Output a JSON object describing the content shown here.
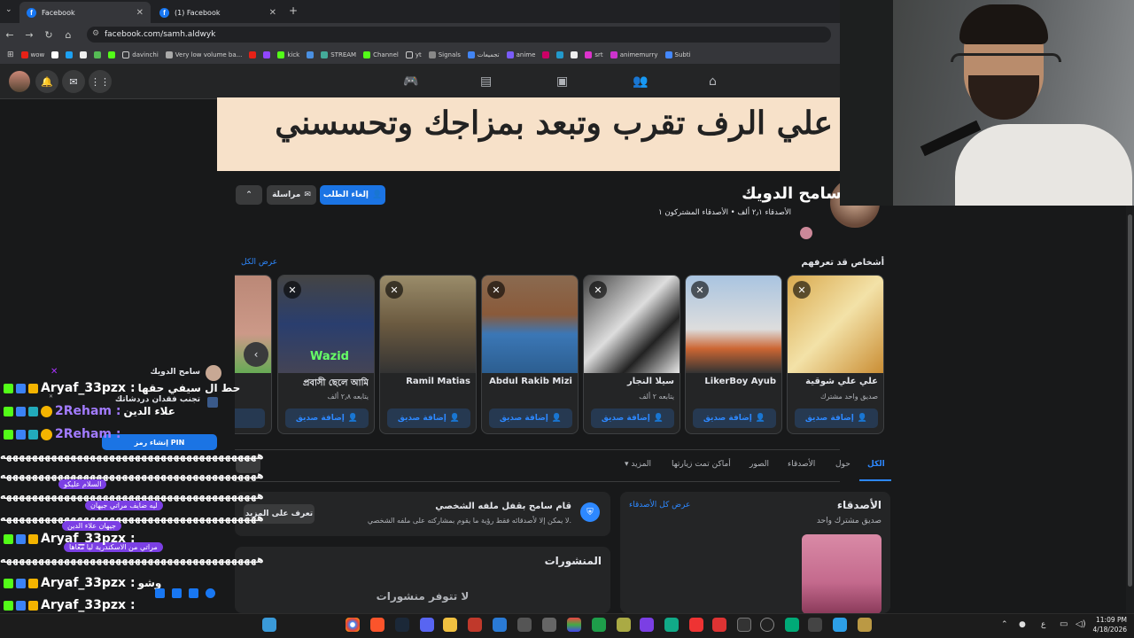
{
  "browser": {
    "tabs": [
      {
        "label": "Facebook"
      },
      {
        "label": "(1) Facebook"
      }
    ],
    "url": "facebook.com/samh.aldwyk",
    "bookmarks": [
      "wow",
      "davinchi",
      "Very low volume ba...",
      "kick",
      "STREAM",
      "Channel",
      "yt",
      "Signals",
      "تجميعات",
      "anime",
      "srt",
      "animemurry",
      "Subti"
    ]
  },
  "cover": {
    "text": "علي الرف تقرب وتبعد بمزاجك وتحسسني"
  },
  "profile": {
    "name": "سامح الدويك",
    "stats": "الأصدقاء ٢٫١ ألف • الأصدقاء المشتركون ١",
    "cancel_request": "إلغاء الطلب",
    "message": "مراسلة"
  },
  "pymk": {
    "title": "أشخاص قد تعرفهم",
    "see_all": "عرض الكل",
    "add_label": "إضافة صديق",
    "cards": [
      {
        "name": "علي علي شوقية",
        "sub": "صديق واحد مشترك"
      },
      {
        "name": "LikerBoy Ayub",
        "sub": ""
      },
      {
        "name": "سيلا النجار",
        "sub": "يتابعه ٢ ألف"
      },
      {
        "name": "Abdul Rakib Mizi",
        "sub": ""
      },
      {
        "name": "Ramil Matias",
        "sub": ""
      },
      {
        "name": "প্রবাসী ছেলে আমি",
        "sub": "يتابعه ٢٫٨ ألف",
        "photo_text": "Wazid"
      }
    ]
  },
  "profile_tabs": [
    "الكل",
    "حول",
    "الأصدقاء",
    "الصور",
    "أماكن تمت زيارتها",
    "المزيد"
  ],
  "friends_panel": {
    "title": "الأصدقاء",
    "see_all": "عرض كل الأصدقاء",
    "sub": "صديق مشترك واحد"
  },
  "locked": {
    "title": "قام سامح بقفل ملفه الشخصي",
    "desc": "لا يمكن إلا لأصدقائه فقط رؤية ما يقوم بمشاركته على ملفه الشخصي.",
    "learn_more": "تعرف على المزيد"
  },
  "posts": {
    "title": "المنشورات",
    "empty": "لا تتوفر منشورات"
  },
  "chat_overlay": {
    "popup_name": "سامح الدويك",
    "lines": [
      {
        "user": "Aryaf_33pzx :",
        "msg": "حط ال سيفي حقها"
      },
      {
        "user": "2Reham :",
        "msg": "علاء الدين"
      },
      {
        "user": "2Reham :",
        "msg": ""
      },
      {
        "user": "Aryaf_33pzx :",
        "msg": ""
      },
      {
        "user": "Aryaf_33pzx :",
        "msg": "وشو"
      },
      {
        "user": "Aryaf_33pzx :",
        "msg": ""
      }
    ],
    "spam": "ههههههههههههههههههههههههههههههههههههههههه",
    "bubbles": [
      "السلام عليكو",
      "ليه ضايف مراتي جيهان",
      "جيهان علاء الدين",
      "مراتي من الاسكندرية ليا معاها"
    ],
    "pin": "إنشاء رمز PIN",
    "warn": "تجنب فقدان دردشاتك"
  },
  "taskbar": {
    "time": "11:09 PM",
    "date": "4/18/2026"
  }
}
